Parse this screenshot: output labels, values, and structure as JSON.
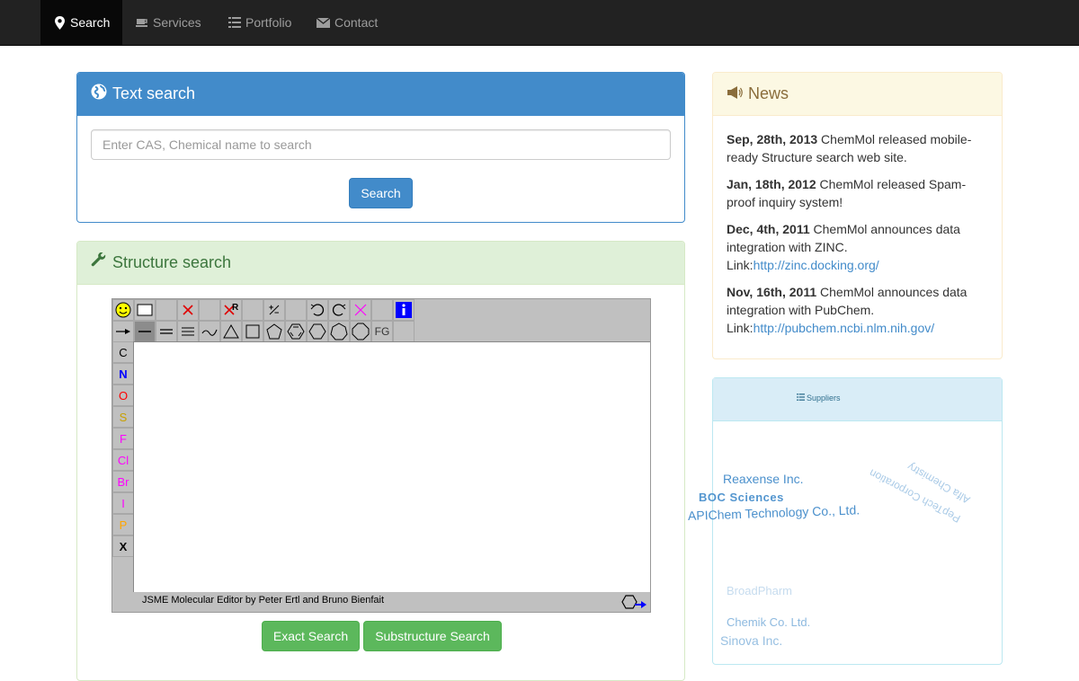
{
  "nav": {
    "items": [
      {
        "label": "Search",
        "icon": "map-marker-icon",
        "active": true
      },
      {
        "label": "Services",
        "icon": "coffee-cup-icon"
      },
      {
        "label": "Portfolio",
        "icon": "list-icon"
      },
      {
        "label": "Contact",
        "icon": "envelope-icon"
      }
    ]
  },
  "text_search": {
    "title": "Text search",
    "icon": "globe-icon",
    "placeholder": "Enter CAS, Chemical name to search",
    "button": "Search"
  },
  "structure_search": {
    "title": "Structure search",
    "icon": "wrench-icon",
    "editor_credit": "JSME Molecular Editor by Peter Ertl and Bruno Bienfait",
    "elements": [
      {
        "symbol": "C",
        "color": "#000000"
      },
      {
        "symbol": "N",
        "color": "#0000ff"
      },
      {
        "symbol": "O",
        "color": "#ff0000"
      },
      {
        "symbol": "S",
        "color": "#c8a000"
      },
      {
        "symbol": "F",
        "color": "#ff00ff"
      },
      {
        "symbol": "Cl",
        "color": "#ff00ff"
      },
      {
        "symbol": "Br",
        "color": "#ff00ff"
      },
      {
        "symbol": "I",
        "color": "#ff00ff"
      },
      {
        "symbol": "P",
        "color": "#ffa500"
      },
      {
        "symbol": "X",
        "color": "#000000"
      }
    ],
    "fg_label": "FG",
    "exact_button": "Exact Search",
    "substructure_button": "Substructure Search"
  },
  "news": {
    "title": "News",
    "icon": "bullhorn-icon",
    "items": [
      {
        "date": "Sep, 28th, 2013",
        "text": " ChemMol released mobile-ready Structure search web site."
      },
      {
        "date": "Jan, 18th, 2012",
        "text": " ChemMol released Spam-proof inquiry system!"
      },
      {
        "date": "Dec, 4th, 2011",
        "text": " ChemMol announces data integration with ZINC.",
        "link_prefix": "Link:",
        "link": "http://zinc.docking.org/"
      },
      {
        "date": "Nov, 16th, 2011",
        "text": " ChemMol announces data integration with PubChem.",
        "link_prefix": "Link:",
        "link": "http://pubchem.ncbi.nlm.nih.gov/"
      }
    ]
  },
  "suppliers": {
    "title": "Suppliers",
    "icon": "list-icon",
    "items": [
      {
        "name": "Reaxense Inc."
      },
      {
        "name": "BOC Sciences"
      },
      {
        "name": "APIChem Technology Co., Ltd."
      },
      {
        "name": "PepTech Corporation"
      },
      {
        "name": "Alfa Chemistry"
      },
      {
        "name": "BroadPharm"
      },
      {
        "name": "Chemik Co. Ltd."
      },
      {
        "name": "Sinova Inc."
      }
    ]
  }
}
